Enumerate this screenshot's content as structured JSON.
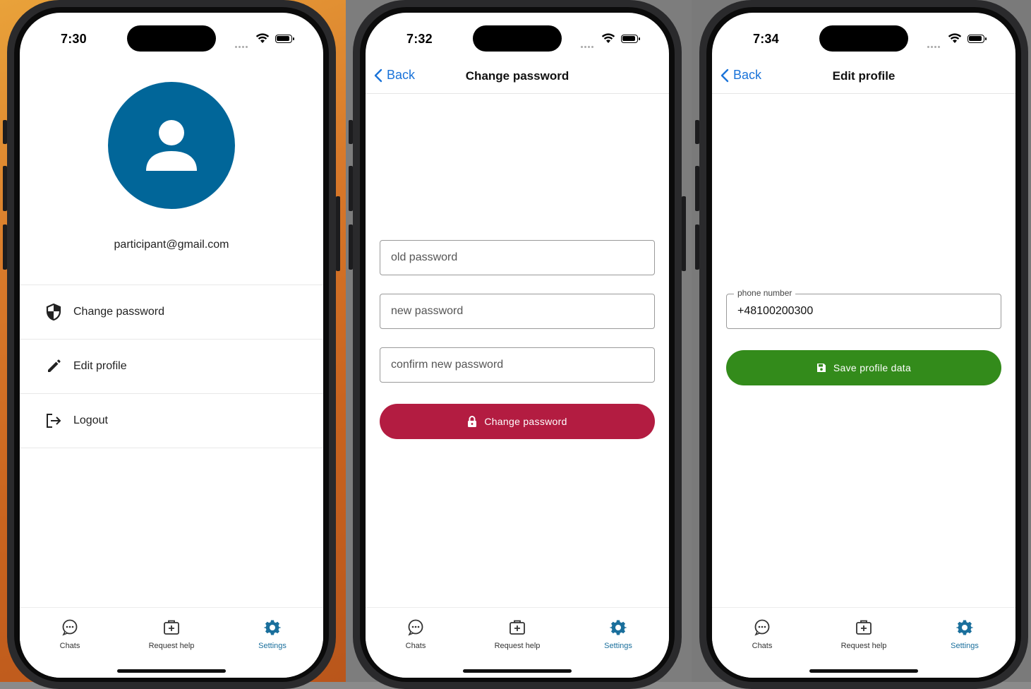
{
  "colors": {
    "brand_blue": "#016699",
    "ios_link": "#1a73d9",
    "danger_red": "#b31c41",
    "success_green": "#338b1b"
  },
  "status_bar": {
    "screen1_time": "7:30",
    "screen2_time": "7:32",
    "screen3_time": "7:34"
  },
  "tabbar": {
    "tabs": [
      {
        "label": "Chats",
        "icon": "chat-bubble-icon"
      },
      {
        "label": "Request help",
        "icon": "medical-kit-icon"
      },
      {
        "label": "Settings",
        "icon": "gear-icon",
        "active": true
      }
    ]
  },
  "settings_screen": {
    "avatar_icon": "person-icon",
    "email": "participant@gmail.com",
    "menu": [
      {
        "label": "Change password",
        "icon": "shield-icon"
      },
      {
        "label": "Edit profile",
        "icon": "pencil-icon"
      },
      {
        "label": "Logout",
        "icon": "logout-icon"
      }
    ]
  },
  "change_password_screen": {
    "back_label": "Back",
    "title": "Change password",
    "old_password_placeholder": "old password",
    "new_password_placeholder": "new password",
    "confirm_password_placeholder": "confirm new password",
    "submit_label": "Change password",
    "submit_icon": "lock-icon"
  },
  "edit_profile_screen": {
    "back_label": "Back",
    "title": "Edit profile",
    "phone_label": "phone number",
    "phone_value": "+48100200300",
    "save_label": "Save profile data",
    "save_icon": "save-icon"
  }
}
